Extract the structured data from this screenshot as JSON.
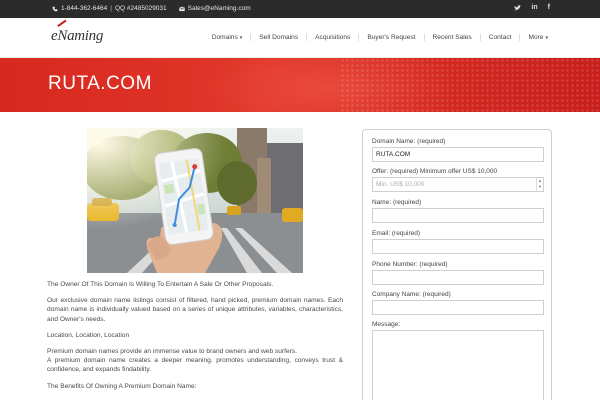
{
  "topbar": {
    "phone": "1-844-362-6464",
    "qq": "QQ #2485029031",
    "email": "Sales@eNaming.com",
    "social": [
      "twitter-icon",
      "linkedin-icon",
      "facebook-icon"
    ]
  },
  "header": {
    "logo": "eNaming",
    "nav": [
      {
        "label": "Domains",
        "has_caret": true
      },
      {
        "label": "Sell Domains",
        "has_caret": false
      },
      {
        "label": "Acquisitions",
        "has_caret": false
      },
      {
        "label": "Buyer's Request",
        "has_caret": false
      },
      {
        "label": "Recent Sales",
        "has_caret": false
      },
      {
        "label": "Contact",
        "has_caret": false
      },
      {
        "label": "More",
        "has_caret": true
      }
    ]
  },
  "banner": {
    "title": "RUTA.COM",
    "color": "#d8281f"
  },
  "content": {
    "paragraphs": [
      "The Owner Of This Domain Is Willing To Entertain A Sale Or Other Proposals.",
      "Our exclusive domain name listings consist of filtered, hand picked, premium domain names. Each domain name is individually valued based on a series of unique attributes, variables, characteristics, and Owner's needs.",
      "Location, Location, Location",
      "Premium domain names provide an immense value to brand owners and web surfers.\nA premium domain name creates a deeper meaning, promotes understanding, conveys trust & confidence, and expands findability.",
      "The Benefits Of Owning A Premium Domain Name:"
    ]
  },
  "form": {
    "domain_label": "Domain Name: (required)",
    "domain_value": "RUTA.COM",
    "offer_label": "Offer: (required) Minimum offer US$ 10,000",
    "offer_placeholder": "Min. US$ 10,000",
    "name_label": "Name: (required)",
    "email_label": "Email: (required)",
    "phone_label": "Phone Number: (required)",
    "company_label": "Company Name: (required)",
    "message_label": "Message:"
  }
}
